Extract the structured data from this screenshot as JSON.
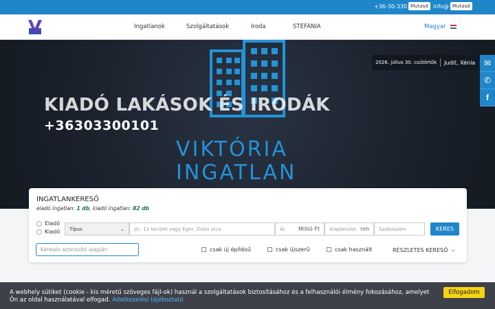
{
  "topbar": {
    "phone": "+36-30-330",
    "phone_button": "Mutasd",
    "email": "info@",
    "email_button": "Mutasd"
  },
  "nav": {
    "items": [
      "Ingatlanok",
      "Szolgáltatások",
      "Iroda",
      "STEFÁNIA"
    ],
    "language": "Magyar"
  },
  "hero": {
    "title": "KIADÓ LAKÁSOK ÉS IRODÁK",
    "phone": "+36303300101",
    "brand_line1": "VIKTÓRIA",
    "brand_line2": "INGATLAN",
    "date": "2026. július 30. csütörtök",
    "namedays": "Judit, Xénia"
  },
  "search": {
    "title": "INGATLANKERESŐ",
    "subtitle_prefix": "eladó ingatlan: ",
    "sale_count": "1 db",
    "subtitle_mid": ", kiadó ingatlan: ",
    "rent_count": "82 db",
    "radio_sale": "Eladó",
    "radio_rent": "Kiadó",
    "type_value": "Típus",
    "location_placeholder": "pl.: 13 kerület vagy Eger, Dobó utca",
    "price_placeholder": "Ár",
    "price_unit": "Millió Ft",
    "area_placeholder": "Alapterület",
    "area_unit": "nm",
    "rooms_placeholder": "Szobaszám",
    "search_button": "KERES",
    "id_placeholder": "Keresés azonosító alapján",
    "check_new_build": "csak új építésű",
    "check_like_new": "csak újszerű",
    "check_used": "csak használt",
    "detailed_search": "RÉSZLETES KERESŐ"
  },
  "cookie": {
    "line1": "A webhely sütiket (cookie - kis méretű szöveges fájl-ok) használ a szolgáltatások biztosításához és a felhasználói élmény fokozásához, amelyet",
    "line2": "Ön az oldal használatával elfogad.",
    "link": "Adatkezelési tájékoztató",
    "accept": "Elfogadom"
  },
  "colors": {
    "accent": "#1f86c9",
    "brand": "#2493d8",
    "cookie_button": "#f5d315"
  }
}
